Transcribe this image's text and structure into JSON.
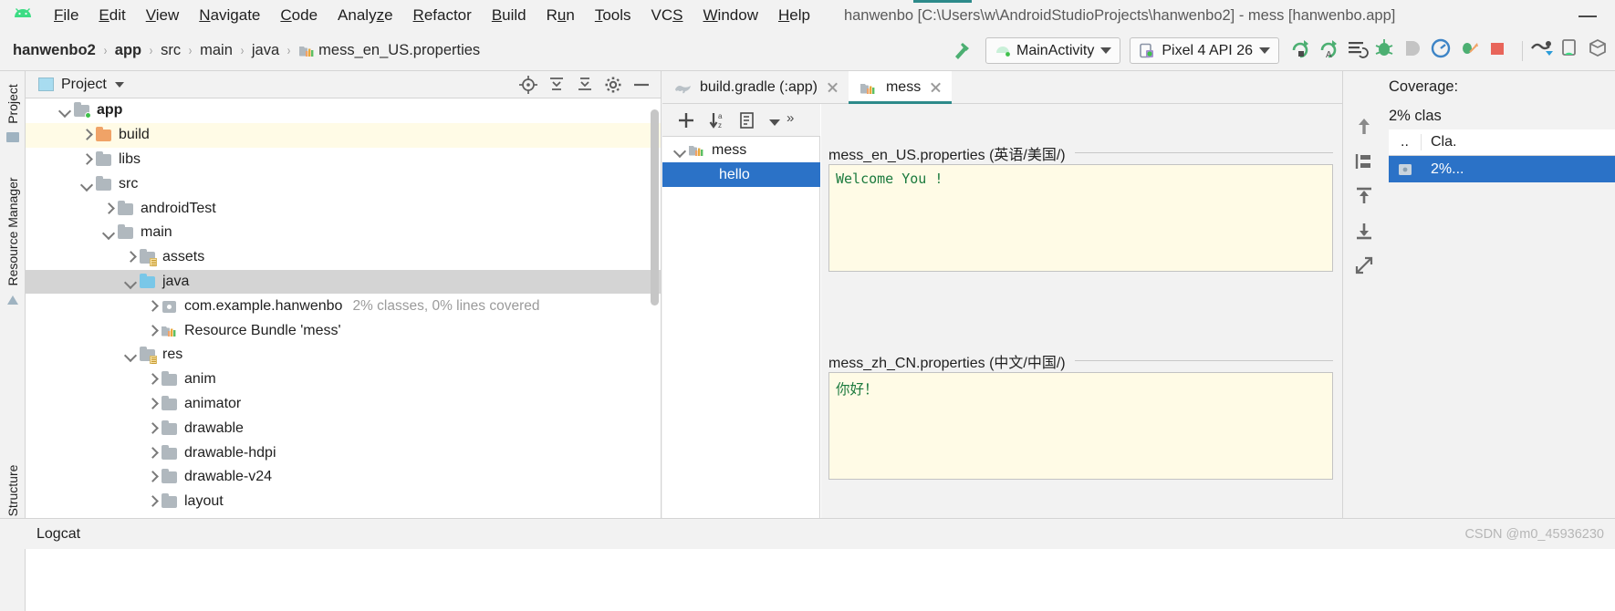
{
  "window": {
    "title": "hanwenbo [C:\\Users\\w\\AndroidStudioProjects\\hanwenbo2] - mess [hanwenbo.app]",
    "minimize_label": "—"
  },
  "menubar": {
    "logo_name": "android-studio-logo",
    "items": [
      {
        "label": "File",
        "mnemonic": "F"
      },
      {
        "label": "Edit",
        "mnemonic": "E"
      },
      {
        "label": "View",
        "mnemonic": "V"
      },
      {
        "label": "Navigate",
        "mnemonic": "N"
      },
      {
        "label": "Code",
        "mnemonic": "C"
      },
      {
        "label": "Analyze",
        "mnemonic": "z"
      },
      {
        "label": "Refactor",
        "mnemonic": "R"
      },
      {
        "label": "Build",
        "mnemonic": "B"
      },
      {
        "label": "Run",
        "mnemonic": "u"
      },
      {
        "label": "Tools",
        "mnemonic": "T"
      },
      {
        "label": "VCS",
        "mnemonic": "S"
      },
      {
        "label": "Window",
        "mnemonic": "W"
      },
      {
        "label": "Help",
        "mnemonic": "H"
      }
    ]
  },
  "breadcrumb": {
    "separator": "›",
    "items": [
      {
        "label": "hanwenbo2",
        "bold": true
      },
      {
        "label": "app",
        "bold": true
      },
      {
        "label": "src",
        "bold": false
      },
      {
        "label": "main",
        "bold": false
      },
      {
        "label": "java",
        "bold": false
      },
      {
        "label": "mess_en_US.properties",
        "bold": false,
        "icon": "resource-bundle-icon"
      }
    ]
  },
  "toolbar": {
    "hammer_icon": "build-hammer-icon",
    "run_config": "MainActivity",
    "device": "Pixel 4 API 26",
    "buttons": [
      "run-button",
      "run-coverage-button",
      "apply-changes-button",
      "debug-button",
      "attach-debugger-button",
      "profiler-button",
      "run-with-coverage-button",
      "stop-button",
      "sync-gradle-button",
      "avd-manager-button",
      "sdk-manager-button"
    ]
  },
  "left_rail": {
    "items": [
      "Project",
      "Resource Manager",
      "Structure"
    ]
  },
  "project_panel": {
    "title": "Project",
    "view_icon": "project-view-icon",
    "tools": [
      "locate-icon",
      "expand-all-icon",
      "collapse-all-icon",
      "settings-gear-icon",
      "hide-icon"
    ],
    "tree": [
      {
        "label": "app",
        "depth": 0,
        "twisty": "down",
        "icon": "module-folder-icon",
        "bold": true,
        "state": "normal",
        "note": ""
      },
      {
        "label": "build",
        "depth": 1,
        "twisty": "right",
        "icon": "folder-orange-icon",
        "bold": false,
        "state": "highlight-yellow",
        "note": ""
      },
      {
        "label": "libs",
        "depth": 1,
        "twisty": "right",
        "icon": "folder-icon",
        "bold": false,
        "state": "normal",
        "note": ""
      },
      {
        "label": "src",
        "depth": 1,
        "twisty": "down",
        "icon": "folder-icon",
        "bold": false,
        "state": "normal",
        "note": ""
      },
      {
        "label": "androidTest",
        "depth": 2,
        "twisty": "right",
        "icon": "folder-icon",
        "bold": false,
        "state": "normal",
        "note": ""
      },
      {
        "label": "main",
        "depth": 2,
        "twisty": "down",
        "icon": "folder-icon",
        "bold": false,
        "state": "normal",
        "note": ""
      },
      {
        "label": "assets",
        "depth": 3,
        "twisty": "right",
        "icon": "folder-resource-icon",
        "bold": false,
        "state": "normal",
        "note": ""
      },
      {
        "label": "java",
        "depth": 3,
        "twisty": "down",
        "icon": "folder-blue-icon",
        "bold": false,
        "state": "selected",
        "note": ""
      },
      {
        "label": "com.example.hanwenbo",
        "depth": 4,
        "twisty": "right",
        "icon": "package-icon",
        "bold": false,
        "state": "normal",
        "note": "2% classes, 0% lines covered"
      },
      {
        "label": "Resource Bundle 'mess'",
        "depth": 4,
        "twisty": "right",
        "icon": "resource-bundle-icon",
        "bold": false,
        "state": "normal",
        "note": ""
      },
      {
        "label": "res",
        "depth": 3,
        "twisty": "down",
        "icon": "folder-resource-icon",
        "bold": false,
        "state": "normal",
        "note": ""
      },
      {
        "label": "anim",
        "depth": 4,
        "twisty": "right",
        "icon": "folder-icon",
        "bold": false,
        "state": "normal",
        "note": ""
      },
      {
        "label": "animator",
        "depth": 4,
        "twisty": "right",
        "icon": "folder-icon",
        "bold": false,
        "state": "normal",
        "note": ""
      },
      {
        "label": "drawable",
        "depth": 4,
        "twisty": "right",
        "icon": "folder-icon",
        "bold": false,
        "state": "normal",
        "note": ""
      },
      {
        "label": "drawable-hdpi",
        "depth": 4,
        "twisty": "right",
        "icon": "folder-icon",
        "bold": false,
        "state": "normal",
        "note": ""
      },
      {
        "label": "drawable-v24",
        "depth": 4,
        "twisty": "right",
        "icon": "folder-icon",
        "bold": false,
        "state": "normal",
        "note": ""
      },
      {
        "label": "layout",
        "depth": 4,
        "twisty": "right",
        "icon": "folder-icon",
        "bold": false,
        "state": "normal",
        "note": ""
      }
    ]
  },
  "editor": {
    "tabs": [
      {
        "label": "build.gradle (:app)",
        "icon": "gradle-elephant-icon",
        "active": false,
        "closable": true
      },
      {
        "label": "mess",
        "icon": "resource-bundle-icon",
        "active": true,
        "closable": true
      }
    ]
  },
  "resource_bundle": {
    "toolbar": {
      "add_label": "+",
      "sort_label": "sort-az-icon",
      "group_label": "group-icon",
      "dropdown_label": "dropdown-icon",
      "overflow_label": "»"
    },
    "keys_tree": [
      {
        "label": "mess",
        "depth": 0,
        "twisty": "down",
        "icon": "resource-bundle-icon",
        "selected": false
      },
      {
        "label": "hello",
        "depth": 1,
        "twisty": "none",
        "icon": "",
        "selected": true
      }
    ],
    "locales": [
      {
        "title": "mess_en_US.properties (英语/美国/)",
        "value": "Welcome You !",
        "cjk": false
      },
      {
        "title": "mess_zh_CN.properties (中文/中国/)",
        "value": "你好！",
        "cjk": true
      }
    ]
  },
  "coverage_panel": {
    "title": "Coverage:",
    "summary": "2% clas",
    "tools": [
      "up-arrow-icon",
      "flatten-packages-icon",
      "export-icon",
      "import-icon",
      "expand-icon"
    ],
    "table": {
      "headers": [
        "..",
        "Cla."
      ],
      "rows": [
        {
          "icon": "package-icon",
          "cells": [
            "",
            "2%..."
          ],
          "selected": true
        }
      ]
    }
  },
  "bottom": {
    "logcat_label": "Logcat",
    "watermark": "CSDN @m0_45936230"
  },
  "colors": {
    "accent_teal": "#2d8a8a",
    "selection_blue": "#2b72c7",
    "highlight_yellow": "#fffbe6",
    "value_green": "#1b7a3d",
    "android_green": "#3ddc84"
  }
}
